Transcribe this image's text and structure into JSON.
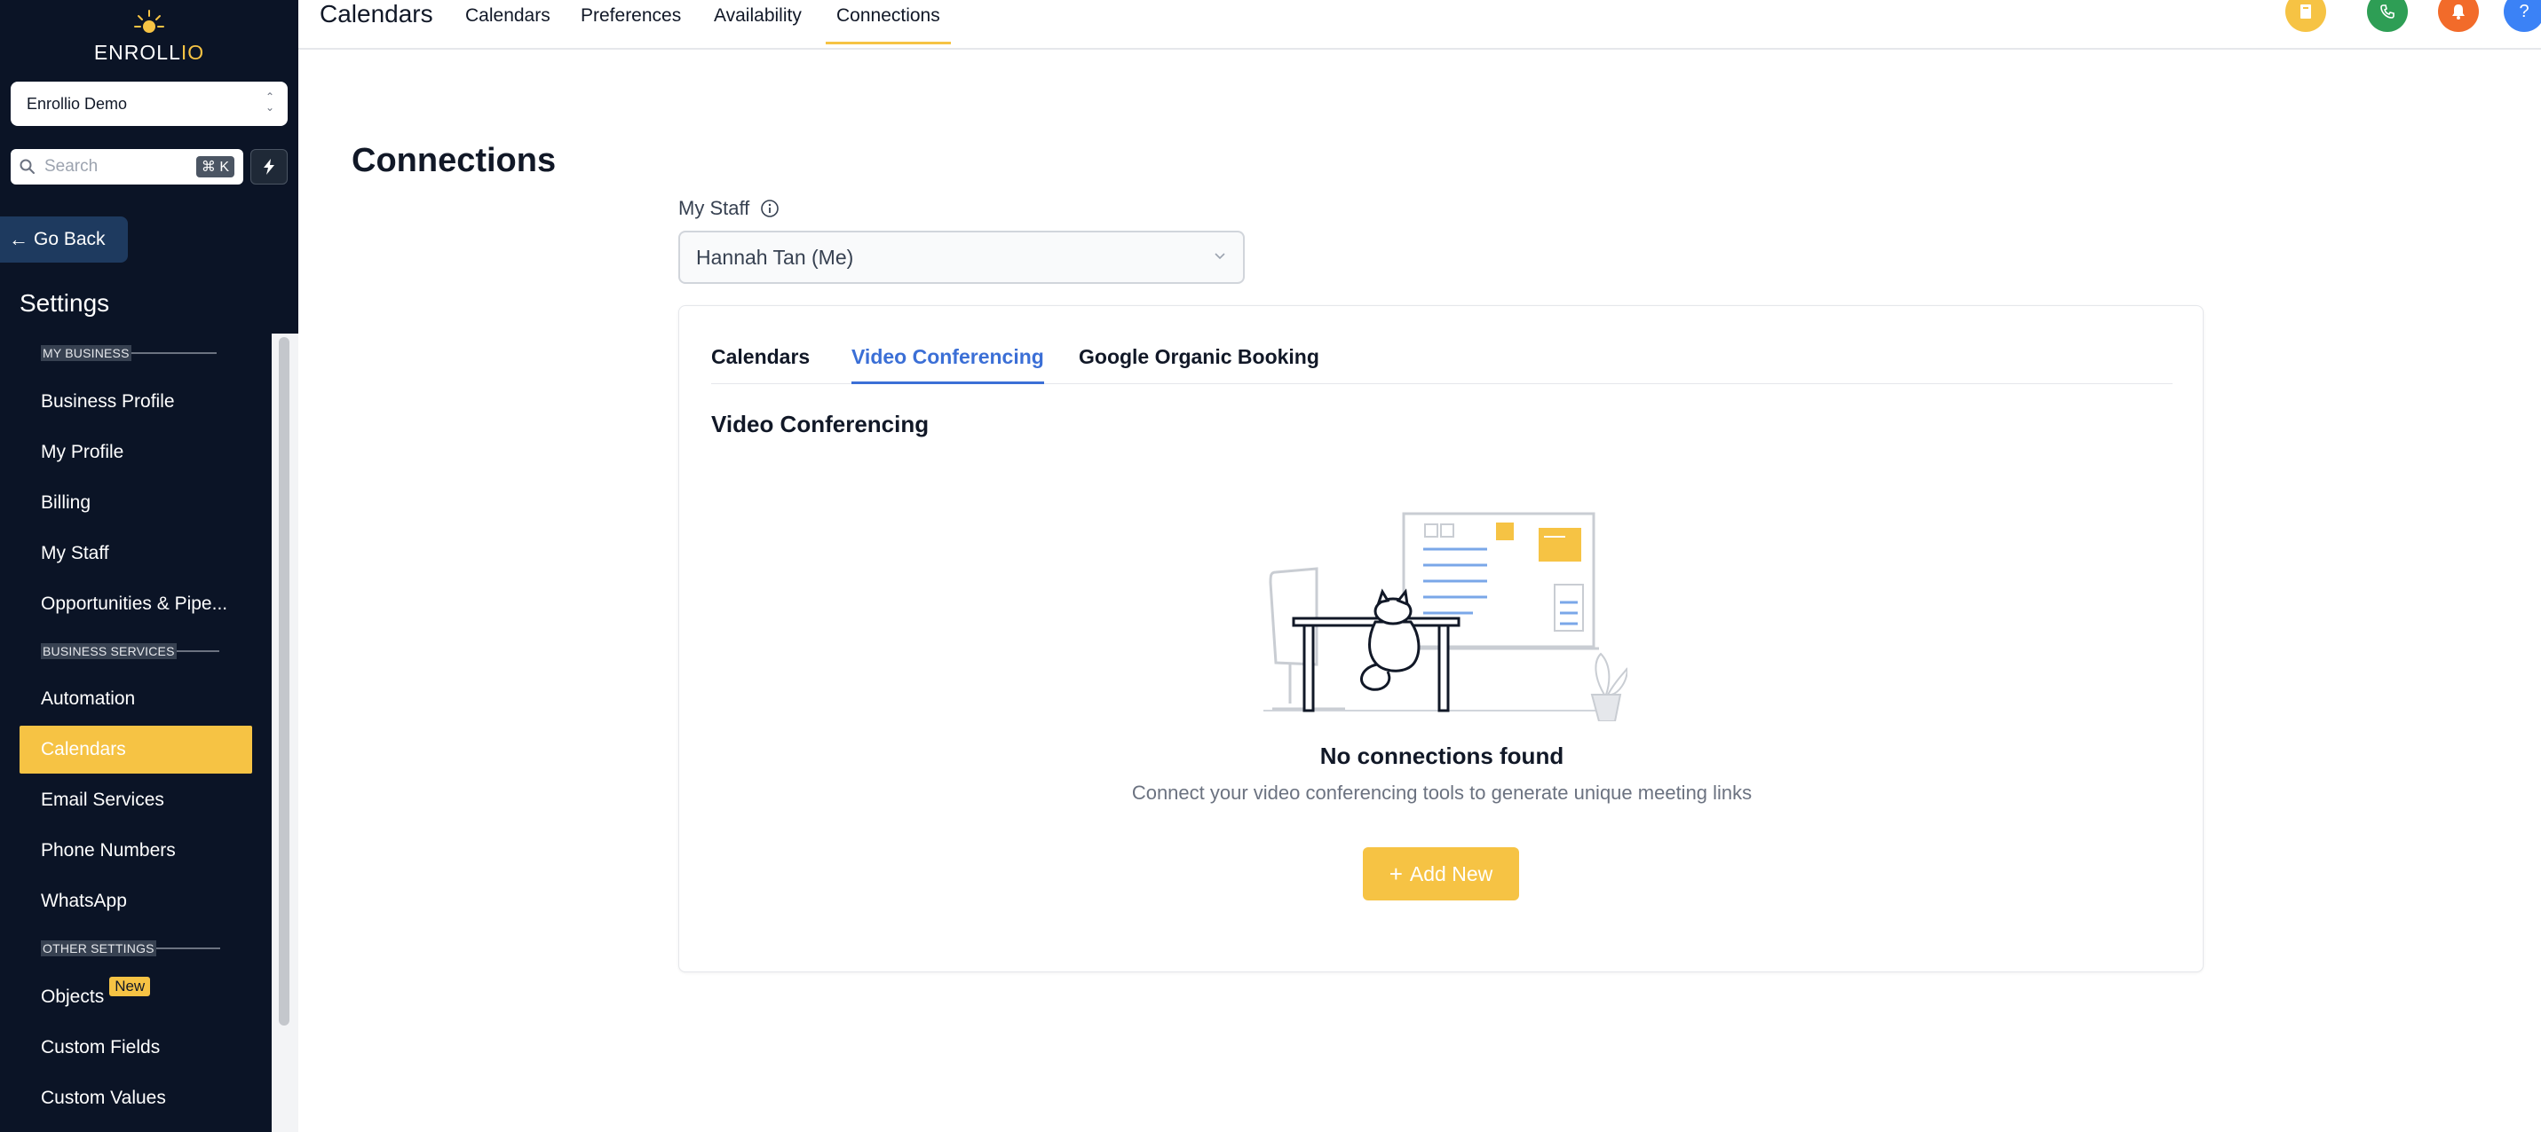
{
  "brand": {
    "name_main": "ENROLL",
    "name_accent": "IO",
    "colors": {
      "accent": "#f6c344",
      "sidebar": "#0b1426",
      "link_active": "#3b6fd6"
    }
  },
  "sidebar": {
    "account_name": "Enrollio Demo",
    "search_placeholder": "Search",
    "search_shortcut": "⌘ K",
    "go_back_label": "Go Back",
    "settings_title": "Settings",
    "sections": {
      "my_business": "MY BUSINESS",
      "business_services": "BUSINESS SERVICES",
      "other_settings": "OTHER SETTINGS"
    },
    "items": {
      "business_profile": "Business Profile",
      "my_profile": "My Profile",
      "billing": "Billing",
      "my_staff": "My Staff",
      "opportunities": "Opportunities & Pipe...",
      "automation": "Automation",
      "calendars": "Calendars",
      "email_services": "Email Services",
      "phone_numbers": "Phone Numbers",
      "whatsapp": "WhatsApp",
      "objects": "Objects",
      "objects_badge": "New",
      "custom_fields": "Custom Fields",
      "custom_values": "Custom Values"
    },
    "active_item": "calendars"
  },
  "topbar": {
    "title": "Calendars",
    "tabs": {
      "calendars": "Calendars",
      "preferences": "Preferences",
      "availability": "Availability",
      "connections": "Connections"
    },
    "active_tab": "connections",
    "icons": [
      "book-icon",
      "phone-icon",
      "bell-icon",
      "help-icon"
    ]
  },
  "main": {
    "page_title": "Connections",
    "staff_label": "My Staff",
    "staff_selected": "Hannah Tan (Me)",
    "card": {
      "tabs": {
        "calendars": "Calendars",
        "video_conferencing": "Video Conferencing",
        "google_organic_booking": "Google Organic Booking"
      },
      "active_tab": "video_conferencing",
      "heading": "Video Conferencing",
      "empty_title": "No connections found",
      "empty_subtitle": "Connect your video conferencing tools to generate unique meeting links",
      "add_button_label": "Add New"
    }
  }
}
